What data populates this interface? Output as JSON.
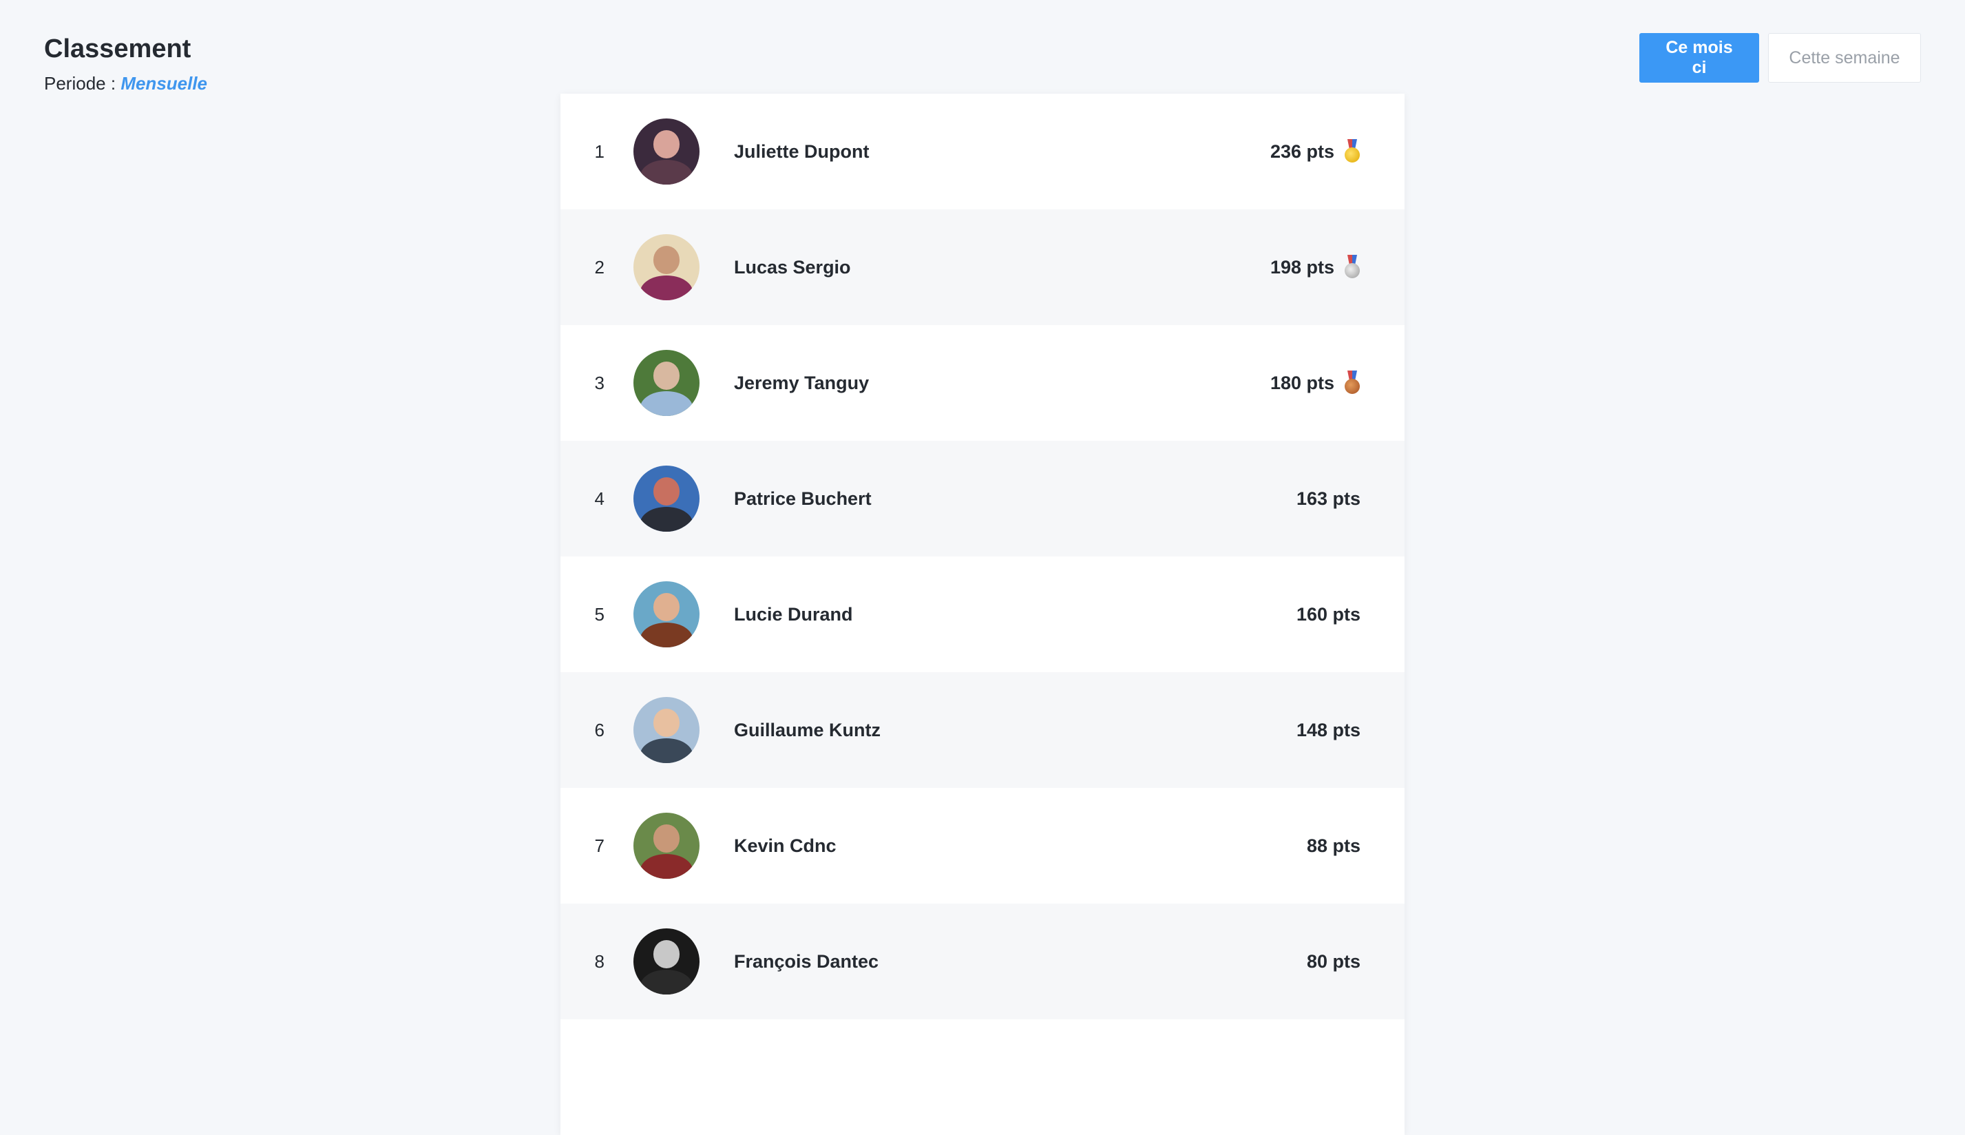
{
  "header": {
    "title": "Classement",
    "period_label": "Periode :",
    "period_value": "Mensuelle"
  },
  "toggle": {
    "month_label": "Ce mois ci",
    "week_label": "Cette semaine",
    "active": "month"
  },
  "leaderboard": {
    "rows": [
      {
        "rank": "1",
        "name": "Juliette Dupont",
        "points": "236 pts",
        "medal": "gold-medal-icon",
        "avatar_colors": [
          "#3b2a3d",
          "#d9a49a",
          "#5a3a4a"
        ]
      },
      {
        "rank": "2",
        "name": "Lucas Sergio",
        "points": "198 pts",
        "medal": "silver-medal-icon",
        "avatar_colors": [
          "#e8d9b8",
          "#c99a7a",
          "#8a2d5a"
        ]
      },
      {
        "rank": "3",
        "name": "Jeremy Tanguy",
        "points": "180 pts",
        "medal": "bronze-medal-icon",
        "avatar_colors": [
          "#4e7a3a",
          "#d8b8a0",
          "#9ab8d8"
        ]
      },
      {
        "rank": "4",
        "name": "Patrice Buchert",
        "points": "163 pts",
        "medal": null,
        "avatar_colors": [
          "#3b6fb8",
          "#c87060",
          "#2a2e38"
        ]
      },
      {
        "rank": "5",
        "name": "Lucie Durand",
        "points": "160 pts",
        "medal": null,
        "avatar_colors": [
          "#6aa8c8",
          "#e0b090",
          "#7a3a22"
        ]
      },
      {
        "rank": "6",
        "name": "Guillaume Kuntz",
        "points": "148 pts",
        "medal": null,
        "avatar_colors": [
          "#a8c0d8",
          "#e8c0a0",
          "#3a4858"
        ]
      },
      {
        "rank": "7",
        "name": "Kevin Cdnc",
        "points": "88 pts",
        "medal": null,
        "avatar_colors": [
          "#6a8a4a",
          "#c89878",
          "#8a2a2a"
        ]
      },
      {
        "rank": "8",
        "name": "François Dantec",
        "points": "80 pts",
        "medal": null,
        "avatar_colors": [
          "#1a1a1a",
          "#c8c8c8",
          "#2a2a2a"
        ]
      }
    ]
  }
}
